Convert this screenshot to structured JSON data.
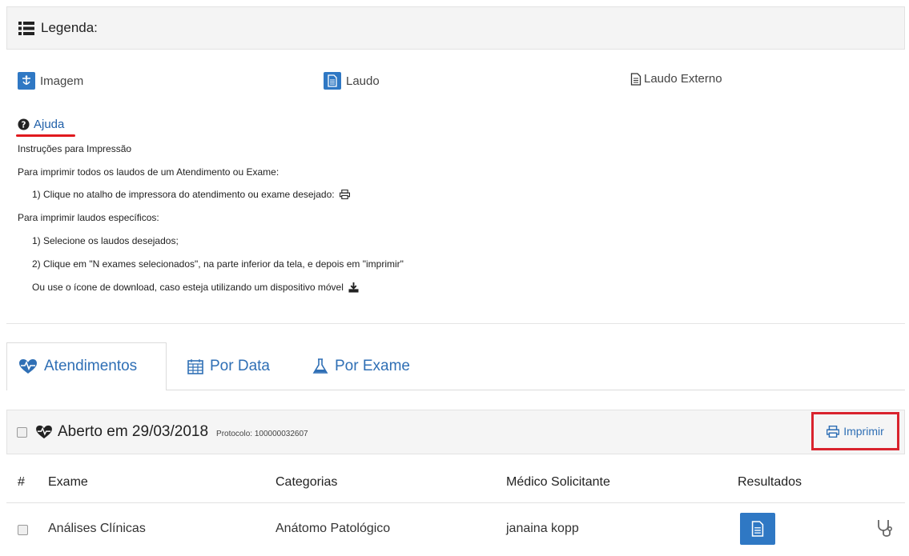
{
  "legend": {
    "title": "Legenda:",
    "items": [
      {
        "label": "Imagem",
        "icon": "image-icon"
      },
      {
        "label": "Laudo",
        "icon": "document-icon"
      },
      {
        "label": "Laudo Externo",
        "icon": "external-document-icon"
      }
    ],
    "help_label": "Ajuda"
  },
  "instructions": {
    "title": "Instruções para Impressão",
    "all_heading": "Para imprimir todos os laudos de um Atendimento ou Exame:",
    "all_step1": "1) Clique no atalho de impressora do atendimento ou exame desejado:",
    "specific_heading": "Para imprimir laudos específicos:",
    "specific_step1": "1) Selecione os laudos desejados;",
    "specific_step2": "2) Clique em \"N exames selecionados\", na parte inferior da tela, e depois em \"imprimir\"",
    "mobile_note": "Ou use o ícone de download, caso esteja utilizando um dispositivo móvel"
  },
  "tabs": [
    {
      "label": "Atendimentos",
      "icon": "heartbeat-icon",
      "active": true
    },
    {
      "label": "Por Data",
      "icon": "calendar-icon",
      "active": false
    },
    {
      "label": "Por Exame",
      "icon": "flask-icon",
      "active": false
    }
  ],
  "visit": {
    "title": "Aberto em 29/03/2018",
    "protocol": "Protocolo: 100000032607",
    "print_label": "Imprimir"
  },
  "table": {
    "headers": [
      "#",
      "Exame",
      "Categorias",
      "Médico Solicitante",
      "Resultados"
    ],
    "rows": [
      {
        "exam": "Análises Clínicas",
        "category": "Anátomo Patológico",
        "doctor": "janaina kopp"
      }
    ]
  },
  "colors": {
    "accent": "#2f78c4",
    "highlight": "#d9232d"
  }
}
